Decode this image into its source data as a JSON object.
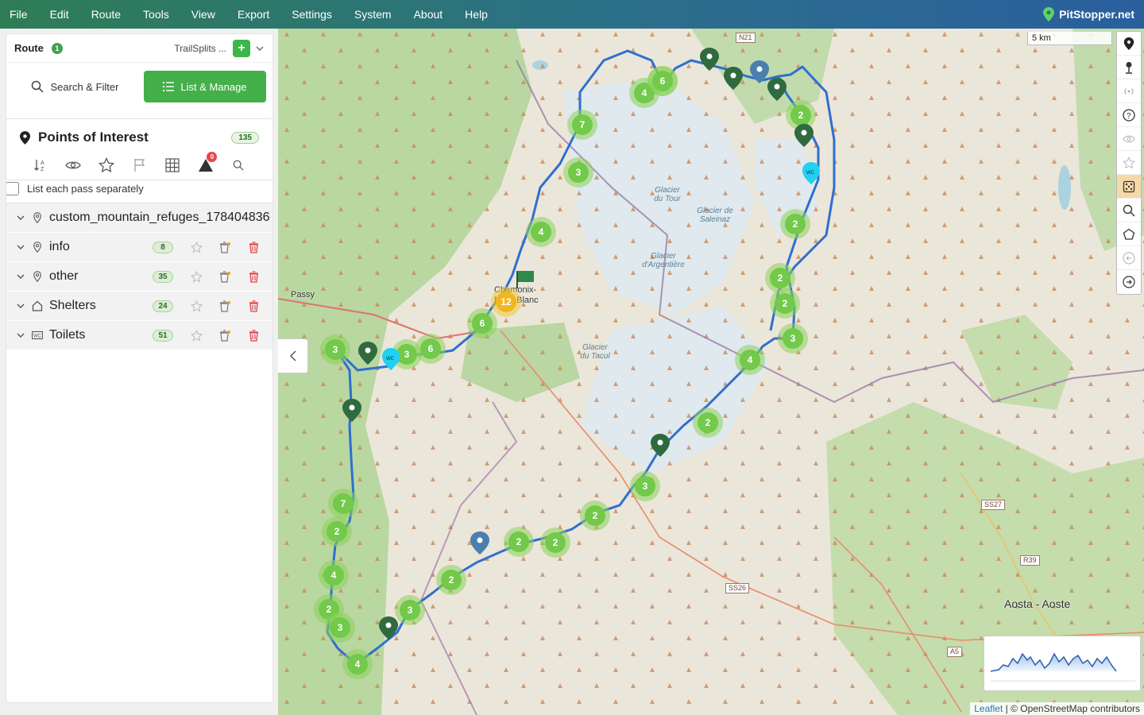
{
  "menu": [
    "File",
    "Edit",
    "Route",
    "Tools",
    "View",
    "Export",
    "Settings",
    "System",
    "About",
    "Help"
  ],
  "brand": "PitStopper.net",
  "route": {
    "label": "Route",
    "count": "1",
    "name": "TrailSplits ...",
    "add_label": "+"
  },
  "tabs": {
    "search": "Search & Filter",
    "list": "List & Manage"
  },
  "poi": {
    "title": "Points of Interest",
    "count": "135",
    "warning_count": "0",
    "separate_label": "List each pass separately",
    "groups": [
      {
        "label": "custom_mountain_refuges_178404836",
        "icon": "pin-icon",
        "count": ""
      },
      {
        "label": "info",
        "icon": "pin-icon",
        "count": "8"
      },
      {
        "label": "other",
        "icon": "pin-icon",
        "count": "35"
      },
      {
        "label": "Shelters",
        "icon": "house-icon",
        "count": "24"
      },
      {
        "label": "Toilets",
        "icon": "wc-icon",
        "count": "51"
      }
    ]
  },
  "map": {
    "scale": "5 km",
    "attribution_leaflet": "Leaflet",
    "attribution_rest": "| © OpenStreetMap contributors",
    "places": {
      "chamonix": "Chamonix-Mont-Blanc",
      "passy": "Passy",
      "aosta": "Aosta - Aoste"
    },
    "glaciers": [
      "Glacier du Tour",
      "Glacier de Saleinaz",
      "Glacier d'Argentière",
      "Glacier du Tacul"
    ],
    "road_signs": [
      "N21",
      "SS27",
      "R39",
      "SS26",
      "A5"
    ],
    "clusters": [
      "6",
      "4",
      "7",
      "3",
      "4",
      "6",
      "12",
      "6",
      "3",
      "6",
      "2",
      "2",
      "2",
      "2",
      "3",
      "4",
      "2",
      "3",
      "2",
      "2",
      "2",
      "2",
      "3",
      "7",
      "2",
      "4",
      "2",
      "3",
      "4",
      "3"
    ]
  }
}
